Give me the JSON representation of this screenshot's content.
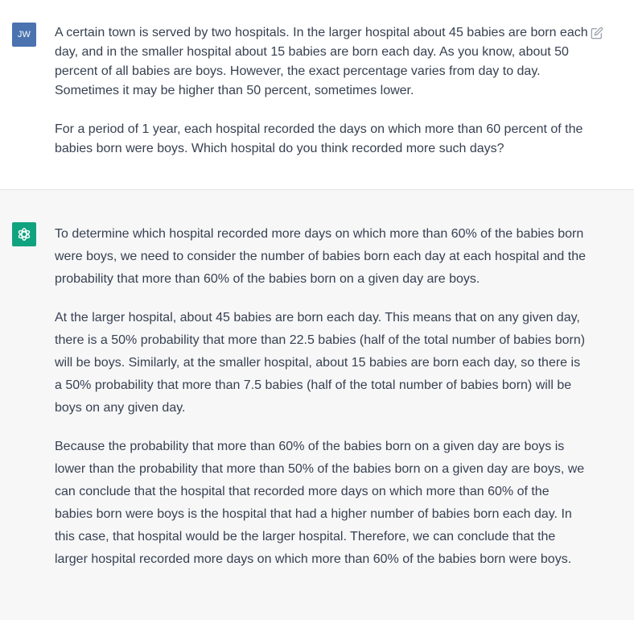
{
  "user_turn": {
    "avatar_initials": "JW",
    "avatar_color": "#4a73b0",
    "edit_icon": "edit-icon",
    "paragraphs": [
      "A certain town is served by two hospitals. In the larger hospital about 45 babies are born each day, and in the smaller hospital about 15 babies are born each day. As you know, about 50 percent of all babies are boys. However, the exact percentage varies from day to day. Sometimes it may be higher than 50 percent, sometimes lower.",
      "For a period of 1 year, each hospital recorded the days on which more than 60 percent of the babies born were boys. Which hospital do you think recorded more such days?"
    ]
  },
  "assistant_turn": {
    "avatar_icon": "openai-logo-icon",
    "avatar_color": "#10a37f",
    "paragraphs": [
      "To determine which hospital recorded more days on which more than 60% of the babies born were boys, we need to consider the number of babies born each day at each hospital and the probability that more than 60% of the babies born on a given day are boys.",
      "At the larger hospital, about 45 babies are born each day. This means that on any given day, there is a 50% probability that more than 22.5 babies (half of the total number of babies born) will be boys. Similarly, at the smaller hospital, about 15 babies are born each day, so there is a 50% probability that more than 7.5 babies (half of the total number of babies born) will be boys on any given day.",
      "Because the probability that more than 60% of the babies born on a given day are boys is lower than the probability that more than 50% of the babies born on a given day are boys, we can conclude that the hospital that recorded more days on which more than 60% of the babies born were boys is the hospital that had a higher number of babies born each day. In this case, that hospital would be the larger hospital. Therefore, we can conclude that the larger hospital recorded more days on which more than 60% of the babies born were boys."
    ]
  }
}
